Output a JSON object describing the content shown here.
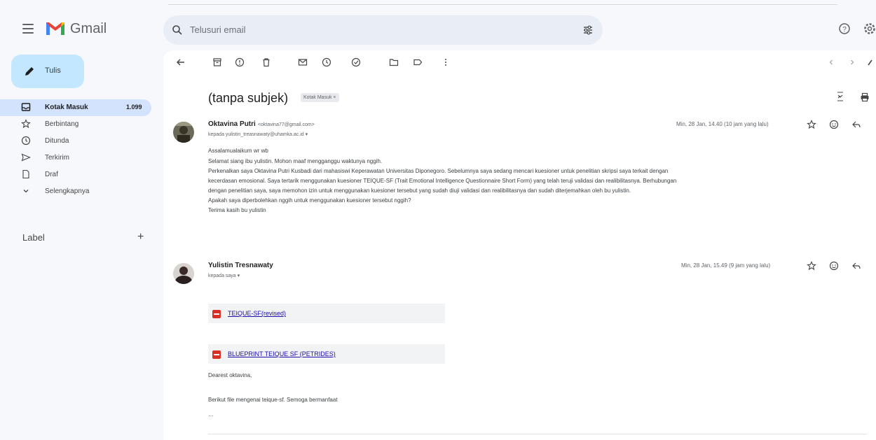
{
  "header": {
    "app_name": "Gmail",
    "search_placeholder": "Telusuri email"
  },
  "sidebar": {
    "compose_label": "Tulis",
    "items": [
      {
        "label": "Kotak Masuk",
        "count": "1.099",
        "icon": "inbox-icon"
      },
      {
        "label": "Berbintang",
        "icon": "star-icon"
      },
      {
        "label": "Ditunda",
        "icon": "clock-icon"
      },
      {
        "label": "Terkirim",
        "icon": "send-icon"
      },
      {
        "label": "Draf",
        "icon": "draft-icon"
      },
      {
        "label": "Selengkapnya",
        "icon": "chevron-down-icon"
      }
    ],
    "label_heading": "Label",
    "label_add": "+"
  },
  "thread": {
    "subject": "(tanpa subjek)",
    "tag": "Kotak Masuk ×",
    "messages": [
      {
        "sender": "Oktavina Putri",
        "email": "<oktavina77@gmail.com>",
        "to": "kepada yulistin_treasnawaty@uhamka.ac.id ▾",
        "date": "Min, 28 Jan, 14.40 (10 jam yang lalu)",
        "body": [
          "Assalamualaikum wr wb",
          "Selamat siang ibu yulistin. Mohon maaf mengganggu waktunya nggih.",
          "Perkenalkan saya Oktavina Putri Kusbadi dari mahasiswi Keperawatan Universitas Diponegoro. Sebelumnya saya sedang mencari kuesioner untuk penelitian skripsi saya terkait dengan",
          "kecerdasan emosional. Saya tertarik menggunakan kuesioner TEIQUE-SF (Trait Emotional Intelligence Questionnaire Short Form) yang telah teruji validasi dan realibilitasnya. Berhubungan",
          "dengan penelitian saya, saya memohon izin untuk menggunakan kuesioner tersebut yang sudah diuji validasi dan realibilitasnya dan sudah diterjemahkan oleh bu yulistin.",
          "Apakah saya diperbolehkan nggih untuk menggunakan kuesioner tersebut nggih?",
          "Terima kasih bu yulistin"
        ]
      },
      {
        "sender": "Yulistin Tresnawaty",
        "to": "kepada saya ▾",
        "date": "Min, 28 Jan, 15.49 (9 jam yang lalu)",
        "attachments": [
          "TEIQUE-SF(revised)",
          "BLUEPRINT TEIQUE SF (PETRIDES)"
        ],
        "body": [
          "Dearest oktavina,",
          "Berikut file mengenai teique-sf. Semoga bermanfaat",
          "···"
        ]
      }
    ]
  },
  "colors": {
    "background": "#f6f8fc",
    "compose": "#c2e7ff",
    "active_nav": "#d3e3fd",
    "link": "#1a0dab",
    "pdf_red": "#d93025"
  }
}
